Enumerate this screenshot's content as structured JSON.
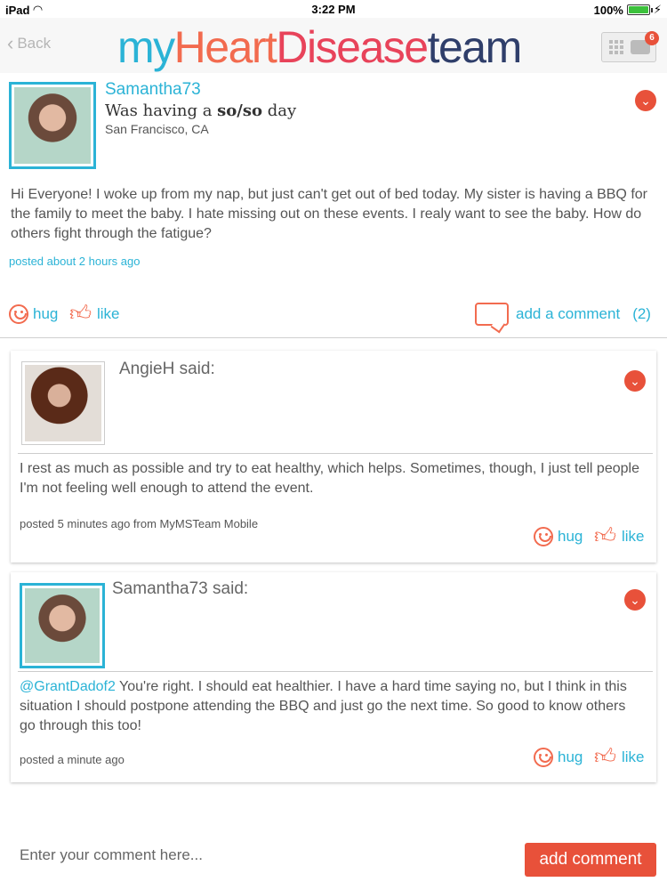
{
  "status_bar": {
    "device": "iPad",
    "time": "3:22 PM",
    "battery": "100%"
  },
  "header": {
    "back_label": "Back",
    "logo": {
      "my": "my",
      "heart": "Heart",
      "disease": "Disease",
      "team": "team"
    },
    "notification_count": "6"
  },
  "post": {
    "username": "Samantha73",
    "mood_prefix": "Was having a ",
    "mood_value": "so/so",
    "mood_suffix": " day",
    "location": "San Francisco, CA",
    "text": "Hi Everyone! I woke up from my nap, but just can't get out of bed today.  My sister is having a BBQ for the family to meet the baby.  I hate missing out on these events.  I realy want to see the baby.  How do others fight through the fatigue?",
    "posted": "posted about 2 hours ago",
    "hug_label": "hug",
    "like_label": "like",
    "add_comment_label": "add a comment",
    "comment_count": "(2)"
  },
  "comments": [
    {
      "said": "AngieH said:",
      "text": "I rest as much as possible and try to eat healthy, which helps.  Sometimes, though, I just tell people I'm not feeling well enough to attend the event.",
      "mention": "",
      "posted": "posted 5 minutes ago from MyMSTeam Mobile",
      "hug_label": "hug",
      "like_label": "like"
    },
    {
      "said": "Samantha73 said:",
      "mention": "@GrantDadof2",
      "text": " You're right. I should eat healthier. I have a hard time saying no, but I think in this situation I should postpone attending the BBQ and just go the next time. So good to know others go through this too!",
      "posted": "posted a  minute ago",
      "hug_label": "hug",
      "like_label": "like"
    }
  ],
  "comment_input": {
    "placeholder": "Enter your comment here..."
  },
  "add_comment_button": "add comment",
  "colors": {
    "accent_blue": "#2bb3d6",
    "accent_orange": "#e8513a"
  }
}
